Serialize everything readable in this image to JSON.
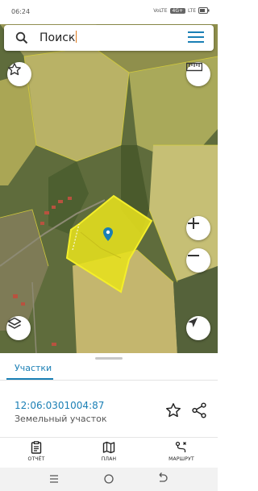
{
  "status_bar": {
    "time": "06:24",
    "indicators": [
      "VoLTE",
      "4G+",
      "LTE"
    ],
    "battery_icon": "battery-icon"
  },
  "search": {
    "text": "Поиск",
    "search_icon": "search-icon",
    "menu_icon": "hamburger-menu-icon"
  },
  "map_controls": {
    "favorite_icon": "star-outline-icon",
    "ruler_icon": "ruler-icon",
    "zoom_in_icon": "plus-icon",
    "zoom_out_icon": "minus-icon",
    "layers_icon": "layers-icon",
    "locate_icon": "navigation-arrow-icon",
    "marker_icon": "location-pin-icon"
  },
  "colors": {
    "accent": "#1a7fb5",
    "parcel_fill": "#e6e01e",
    "parcel_border": "#f4ee2a"
  },
  "sheet": {
    "tab_label": "Участки",
    "cadastral_number": "12:06:0301004:87",
    "parcel_type": "Земельный участок",
    "favorite_icon": "star-outline-icon",
    "share_icon": "share-icon"
  },
  "bottom_nav": {
    "items": [
      {
        "label": "ОТЧЁТ",
        "icon": "report-clipboard-icon"
      },
      {
        "label": "ПЛАН",
        "icon": "map-plan-icon"
      },
      {
        "label": "МАРШРУТ",
        "icon": "route-icon"
      }
    ]
  },
  "system_nav": {
    "icons": [
      "recent-apps-icon",
      "home-icon",
      "back-icon"
    ]
  }
}
